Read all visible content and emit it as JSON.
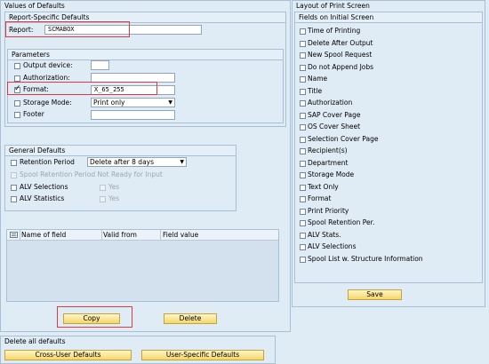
{
  "left_panel": {
    "title": "Values of Defaults",
    "report_group": {
      "title": "Report-Specific Defaults",
      "report_label": "Report:",
      "report_value": "SCMABOX"
    },
    "parameters": {
      "title": "Parameters",
      "output_device": {
        "label": "Output device:",
        "checked": false,
        "value": ""
      },
      "authorization": {
        "label": "Authorization:",
        "checked": false,
        "value": ""
      },
      "format": {
        "label": "Format:",
        "checked": true,
        "value": "X_65_255"
      },
      "storage_mode": {
        "label": "Storage Mode:",
        "checked": false,
        "value": "Print only"
      },
      "footer": {
        "label": "Footer",
        "checked": false,
        "value": ""
      }
    },
    "general": {
      "title": "General Defaults",
      "retention_label": "Retention Period",
      "retention_value": "Delete after 8 days",
      "spool_retention_label": "Spool Retention Period Not Ready for Input",
      "alv_selections_label": "ALV Selections",
      "alv_statistics_label": "ALV Statistics",
      "yes_label": "Yes"
    },
    "table": {
      "columns": [
        "Name of field",
        "Valid from",
        "Field value"
      ]
    },
    "copy_button": "Copy",
    "delete_button": "Delete"
  },
  "right_panel": {
    "title": "Layout of Print Screen",
    "fields_title": "Fields on Initial Screen",
    "items": [
      "Time of Printing",
      "Delete After Output",
      "New Spool Request",
      "Do not Append Jobs",
      "Name",
      "Title",
      "Authorization",
      "SAP Cover Page",
      "OS Cover Sheet",
      "Selection Cover Page",
      "Recipient(s)",
      "Department",
      "Storage Mode",
      "Text Only",
      "Format",
      "Print Priority",
      "Spool Retention Per.",
      "ALV Stats.",
      "ALV Selections",
      "Spool List w. Structure Information"
    ],
    "save_button": "Save"
  },
  "bottom": {
    "title": "Delete all defaults",
    "cross_user_button": "Cross-User Defaults",
    "user_specific_button": "User-Specific Defaults"
  },
  "colors": {
    "background": "#dfebf5",
    "highlight_red": "#e43840",
    "button_yellow": "#f5d768"
  }
}
